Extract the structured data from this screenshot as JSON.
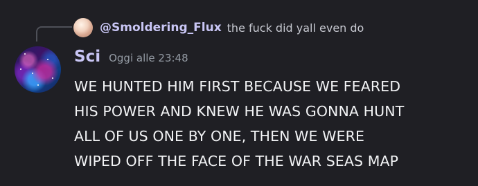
{
  "reply": {
    "username": "@Smoldering_Flux",
    "text": "the fuck did yall even do"
  },
  "message": {
    "username": "Sci",
    "timestamp": "Oggi alle 23:48",
    "lines": [
      "WE HUNTED HIM FIRST BECAUSE WE FEARED",
      "HIS POWER AND KNEW HE WAS GONNA HUNT",
      "ALL OF US ONE BY ONE, THEN WE WERE",
      "WIPED OFF THE FACE OF THE WAR SEAS MAP"
    ]
  },
  "colors": {
    "background": "#1f1f24",
    "username": "#c9c6f5",
    "text": "#f2f3f5",
    "timestamp": "#949ba4"
  }
}
